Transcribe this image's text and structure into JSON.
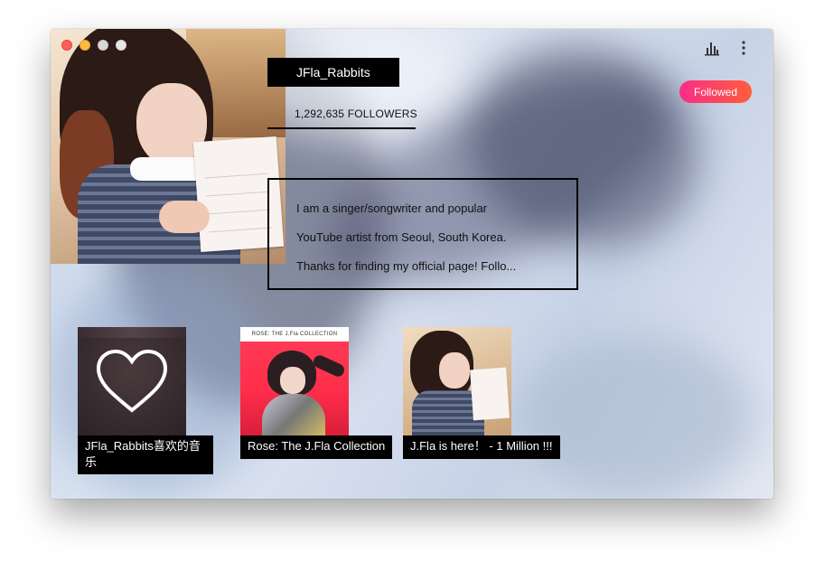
{
  "window": {
    "controls": [
      "close",
      "minimize",
      "zoom",
      "extra"
    ]
  },
  "artist": {
    "name": "JFla_Rabbits",
    "followers": "1,292,635 FOLLOWERS",
    "bio": [
      "I am a singer/songwriter and popular",
      "YouTube artist from Seoul, South Korea.",
      "Thanks for finding my official page! Follo..."
    ]
  },
  "toolbar": {
    "stats_icon": "bar-chart-icon",
    "more_icon": "vertical-ellipsis-icon",
    "follow_label": "Followed"
  },
  "albums": [
    {
      "title": "JFla_Rabbits喜欢的音乐",
      "cover": "heart-icon"
    },
    {
      "title": "Rose: The J.Fla Collection",
      "cover_band": "ROSE: THE J.Fla COLLECTION"
    },
    {
      "title": "J.Fla is here！ - 1 Million !!!"
    }
  ],
  "colors": {
    "follow_gradient_start": "#fa2d88",
    "follow_gradient_end": "#ff5e3a",
    "text_box": "#000000",
    "close": "#fc605c",
    "minimize": "#fdbc40"
  }
}
